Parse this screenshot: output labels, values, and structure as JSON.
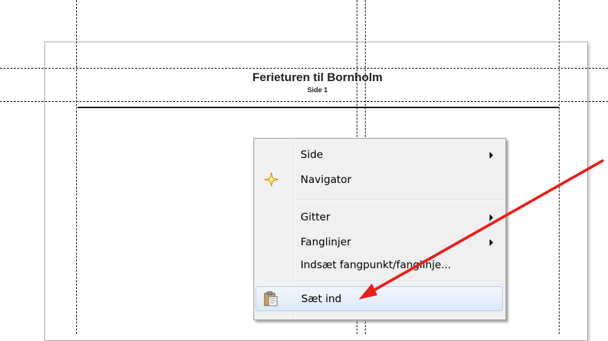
{
  "document": {
    "title": "Ferieturen til Bornholm",
    "subtitle": "Side 1"
  },
  "context_menu": {
    "items": [
      {
        "label": "Side",
        "has_submenu": true
      },
      {
        "label": "Navigator",
        "icon": "navigator-star-icon"
      },
      {
        "label": "Gitter",
        "has_submenu": true
      },
      {
        "label": "Fanglinjer",
        "has_submenu": true
      },
      {
        "label": "Indsæt fangpunkt/fanglinje..."
      },
      {
        "label": "Sæt ind",
        "icon": "clipboard-paste-icon",
        "highlighted": true
      }
    ]
  },
  "annotation": {
    "arrow_color": "#e8201a"
  },
  "colors": {
    "menu_highlight_border": "#aeccf1",
    "guide_line": "#000000"
  }
}
